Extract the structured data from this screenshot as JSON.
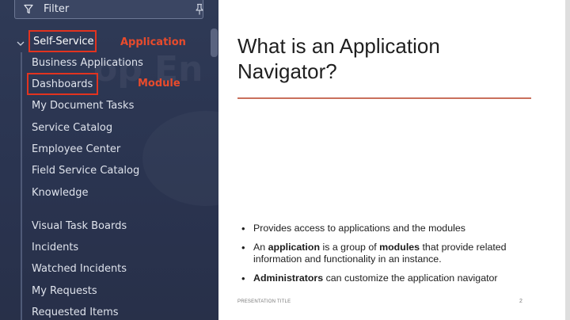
{
  "filter": {
    "placeholder": "Filter"
  },
  "application": {
    "label": "Self-Service",
    "annotation": "Application"
  },
  "module_annotation": "Module",
  "modules_group1": [
    "Business Applications",
    "Dashboards",
    "My Document Tasks",
    "Service Catalog",
    "Employee Center",
    "Field Service Catalog",
    "Knowledge"
  ],
  "modules_group2": [
    "Visual Task Boards",
    "Incidents",
    "Watched Incidents",
    "My Requests",
    "Requested Items"
  ],
  "slide": {
    "title": "What is an Application Navigator?",
    "bullet1": "Provides access to applications and the modules",
    "bullet2": {
      "pre": "An ",
      "b1": "application",
      "mid": " is a group of ",
      "b2": "modules",
      "post": " that provide related information and functionality in an instance."
    },
    "bullet3": {
      "b1": "Administrators",
      "post": " can customize the application navigator"
    },
    "footer_title": "PRESENTATION TITLE",
    "page_number": "2"
  },
  "colors": {
    "nav_bg": "#2f3a56",
    "highlight_red": "#e2331f",
    "annotation_red": "#e84b2c",
    "rule": "#c9705c"
  }
}
